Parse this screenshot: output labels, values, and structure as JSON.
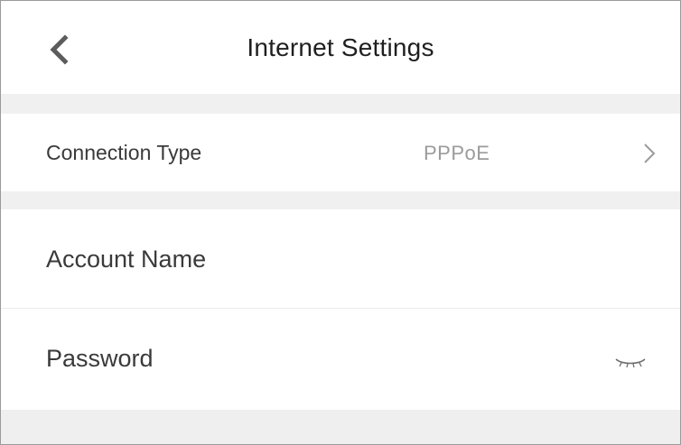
{
  "header": {
    "title": "Internet Settings",
    "back_icon": "chevron-left-icon"
  },
  "connection": {
    "label": "Connection Type",
    "value": "PPPoE",
    "icon": "chevron-right-icon"
  },
  "account": {
    "label": "Account Name"
  },
  "password": {
    "label": "Password",
    "icon": "eye-closed-icon"
  },
  "colors": {
    "background": "#efefef",
    "surface": "#ffffff",
    "text": "#3a3a3a",
    "secondary_text": "#9b9b9b"
  }
}
